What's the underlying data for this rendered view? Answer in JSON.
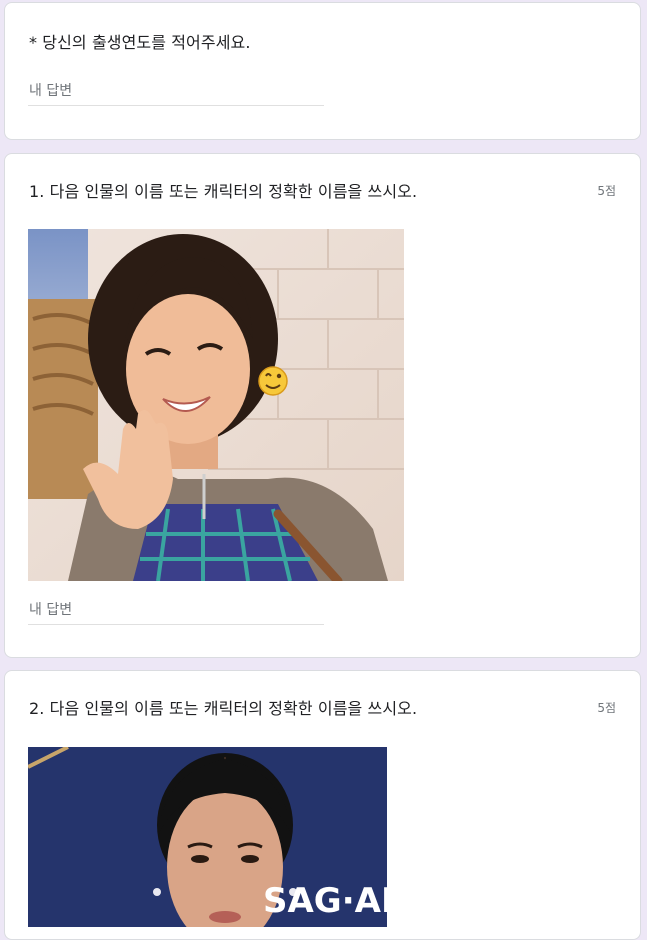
{
  "birth_question": {
    "required_mark": "*",
    "title": "당신의 출생연도를 적어주세요.",
    "answer_placeholder": "내 답변"
  },
  "questions": [
    {
      "title": "1. 다음 인물의 이름 또는 캐릭터의 정확한 이름을 쓰시오.",
      "points": "5점",
      "answer_placeholder": "내 답변",
      "image_emoji": "😉"
    },
    {
      "title": "2. 다음 인물의 이름 또는 캐릭터의 정확한 이름을 쓰시오.",
      "points": "5점",
      "image_text": "SAG·AI"
    }
  ]
}
